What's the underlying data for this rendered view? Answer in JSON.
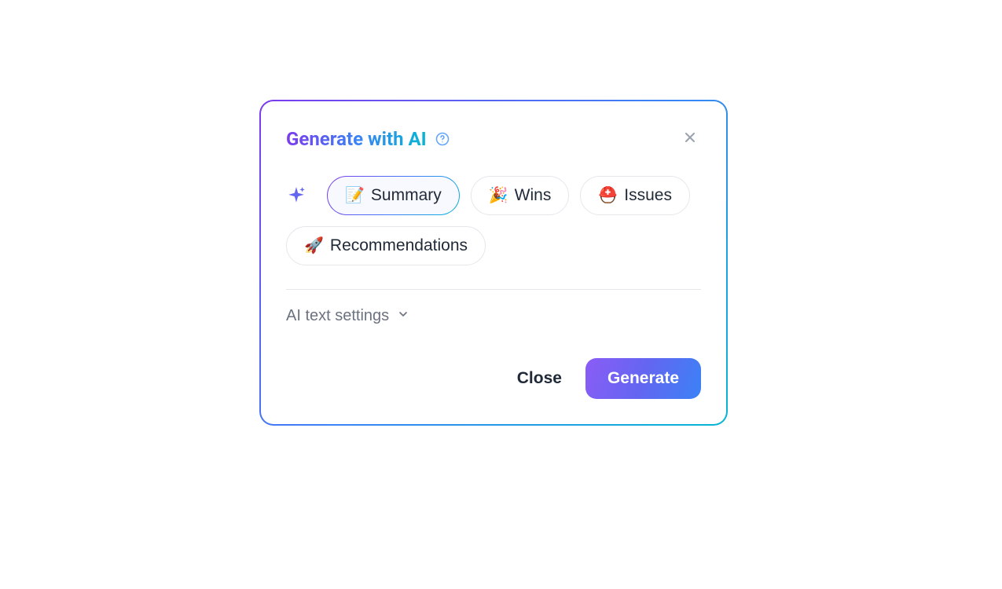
{
  "dialog": {
    "title": "Generate with AI",
    "chips": [
      {
        "emoji": "📝",
        "label": "Summary",
        "selected": true
      },
      {
        "emoji": "🎉",
        "label": "Wins",
        "selected": false
      },
      {
        "emoji": "⛑️",
        "label": "Issues",
        "selected": false
      },
      {
        "emoji": "🚀",
        "label": "Recommendations",
        "selected": false
      }
    ],
    "settings_label": "AI text settings",
    "buttons": {
      "close": "Close",
      "generate": "Generate"
    }
  }
}
